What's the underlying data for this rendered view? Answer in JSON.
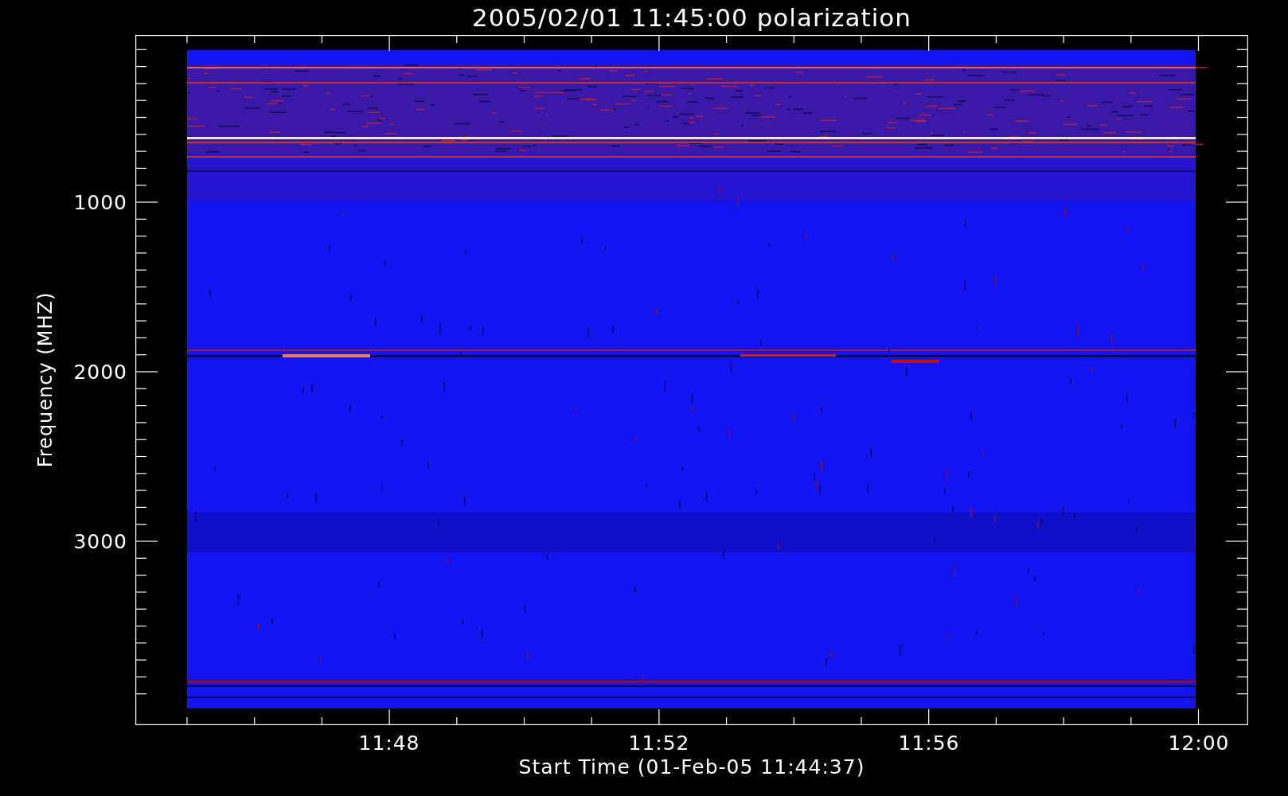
{
  "plot": {
    "title": "2005/02/01 11:45:00 polarization",
    "ylabel": "Frequency (MHZ)",
    "xlabel": "Start Time (01-Feb-05 11:44:37)",
    "yticks": [
      "1000",
      "2000",
      "3000"
    ],
    "xticks": [
      "11:48",
      "11:52",
      "11:56",
      "12:00"
    ]
  }
}
